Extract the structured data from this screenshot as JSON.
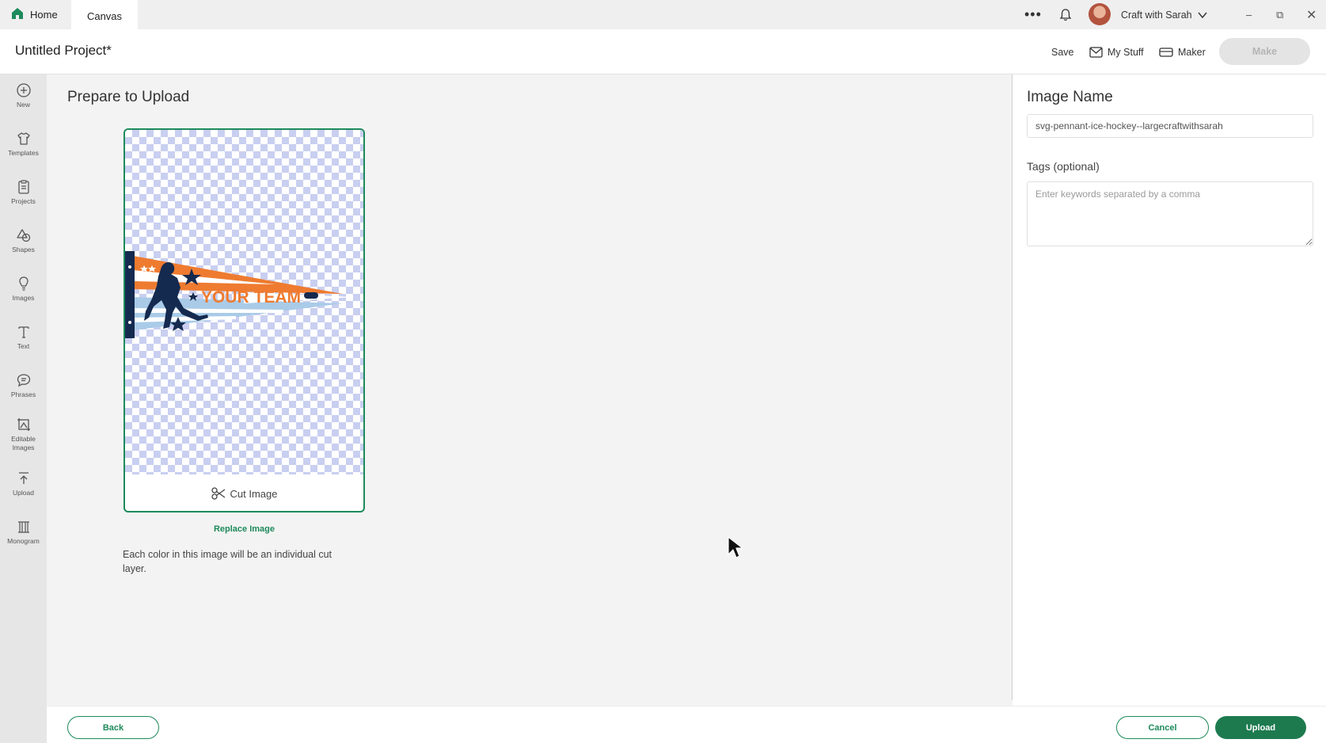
{
  "titlebar": {
    "tabs": [
      {
        "label": "Home",
        "icon": "home-icon",
        "active": false
      },
      {
        "label": "Canvas",
        "active": true
      }
    ],
    "more_icon": "•••",
    "account_name": "Craft with Sarah",
    "window_controls": {
      "minimize": "–",
      "restore": "⧉",
      "close": "✕"
    }
  },
  "project": {
    "title": "Untitled Project*",
    "save_label": "Save",
    "mystuff_label": "My Stuff",
    "maker_label": "Maker",
    "make_label": "Make"
  },
  "sidebar": {
    "items": [
      {
        "label": "New",
        "icon": "plus-circle-icon"
      },
      {
        "label": "Templates",
        "icon": "shirt-icon"
      },
      {
        "label": "Projects",
        "icon": "clipboard-icon"
      },
      {
        "label": "Shapes",
        "icon": "shapes-icon"
      },
      {
        "label": "Images",
        "icon": "lightbulb-icon"
      },
      {
        "label": "Text",
        "icon": "text-icon"
      },
      {
        "label": "Phrases",
        "icon": "speech-bubble-icon"
      },
      {
        "label": "Editable Images",
        "icon": "editable-image-icon"
      },
      {
        "label": "Upload",
        "icon": "upload-icon"
      },
      {
        "label": "Monogram",
        "icon": "monogram-icon"
      }
    ]
  },
  "main": {
    "title": "Prepare to Upload",
    "preview_text": "YOUR TEAM",
    "cut_image_label": "Cut Image",
    "replace_image_label": "Replace Image",
    "note": "Each color in this image will be an individual cut layer."
  },
  "right_panel": {
    "image_name_label": "Image Name",
    "image_name_value": "svg-pennant-ice-hockey--largecraftwithsarah",
    "tags_label": "Tags (optional)",
    "tags_placeholder": "Enter keywords separated by a comma"
  },
  "footer": {
    "back_label": "Back",
    "cancel_label": "Cancel",
    "upload_label": "Upload"
  },
  "colors": {
    "accent": "#1d8a5b",
    "upload_button": "#1d7a4f",
    "pennant_orange": "#ee7b30",
    "pennant_navy": "#152a4f",
    "pennant_blue": "#a9cbe8"
  }
}
